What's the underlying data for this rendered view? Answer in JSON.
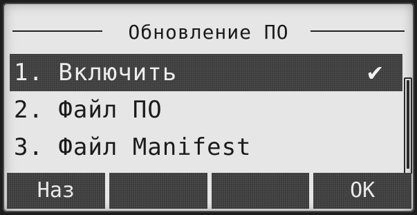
{
  "screen": {
    "title": "Обновление ПО"
  },
  "menu": {
    "items": [
      {
        "label": "1. Включить",
        "selected": true,
        "checked": true
      },
      {
        "label": "2. Файл ПО",
        "selected": false,
        "checked": false
      },
      {
        "label": "3. Файл Manifest",
        "selected": false,
        "checked": false
      }
    ],
    "check_glyph": "✔"
  },
  "softkeys": {
    "keys": [
      "Наз",
      "",
      "",
      "OK"
    ]
  },
  "colors": {
    "lcd_background": "#e6e6e6",
    "highlight": "#3c3c3c",
    "text": "#1b1b1b"
  }
}
